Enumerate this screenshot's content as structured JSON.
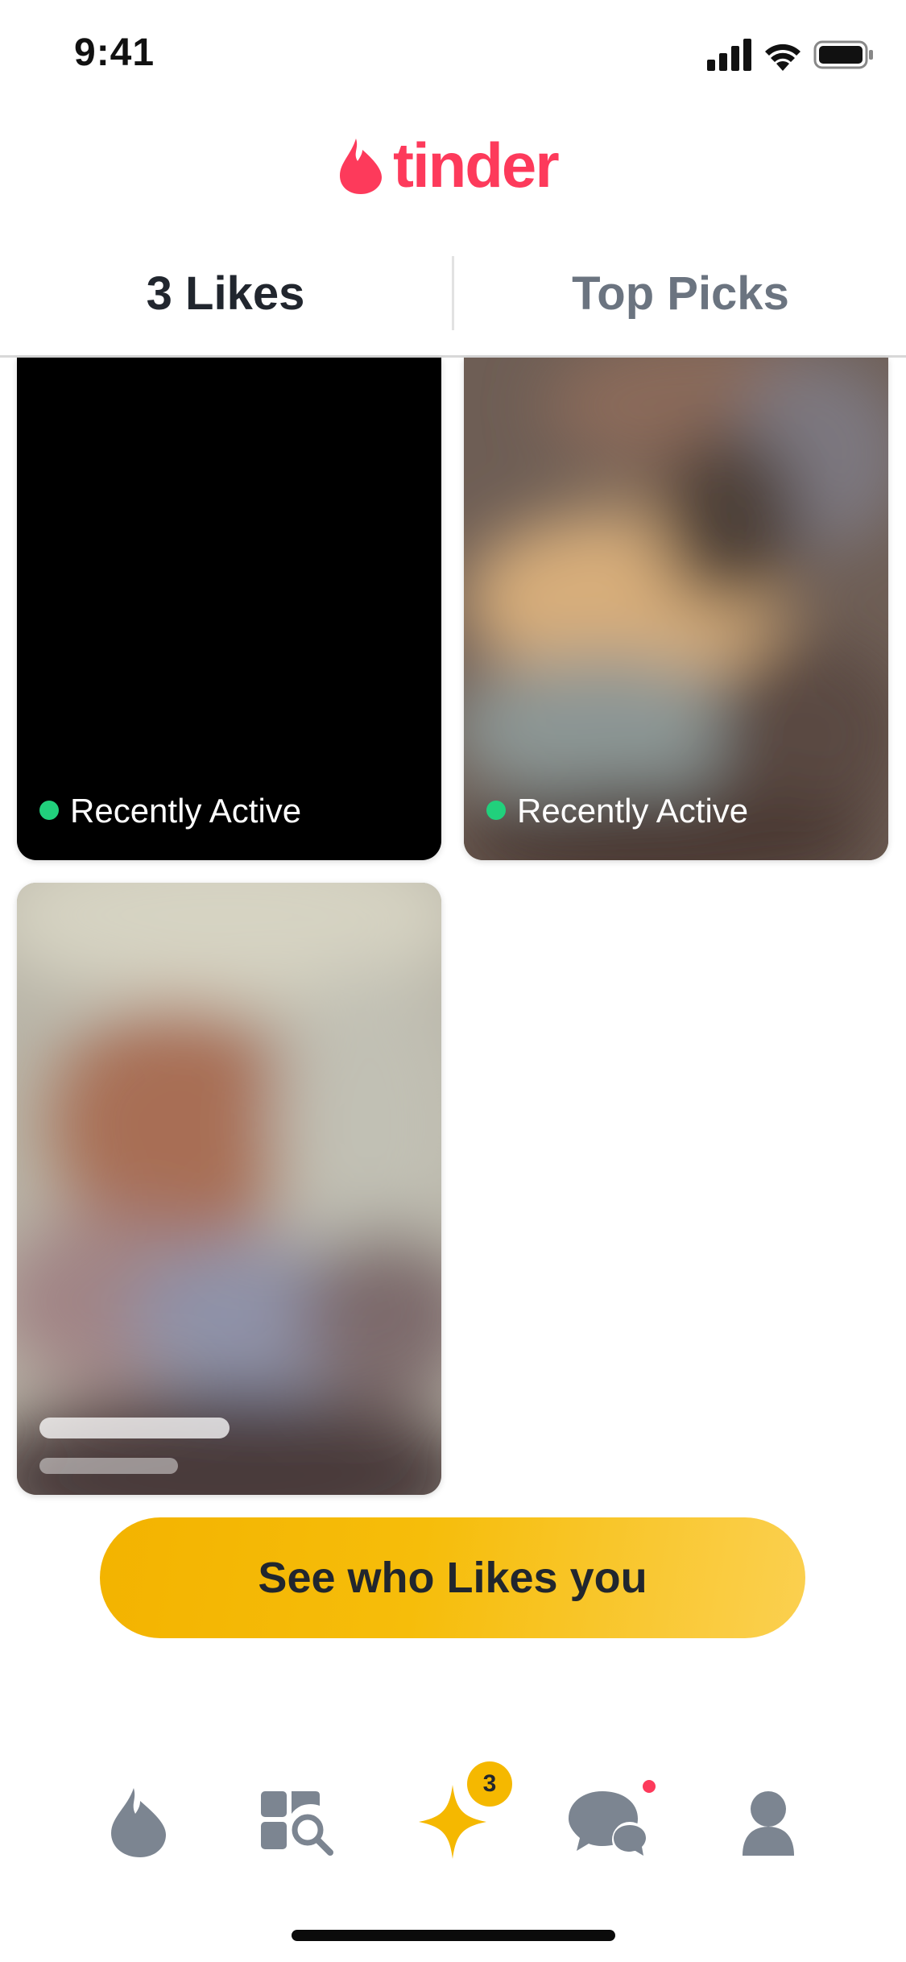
{
  "status_bar": {
    "time": "9:41",
    "icons": [
      "cellular-signal-icon",
      "wifi-icon",
      "battery-icon"
    ]
  },
  "header": {
    "logo_text": "tinder",
    "logo_icon": "flame-icon",
    "brand_color": "#fd3a5b"
  },
  "tabs": [
    {
      "label": "3 Likes",
      "selected": true
    },
    {
      "label": "Top Picks",
      "selected": false
    }
  ],
  "cards": [
    {
      "status": "Recently Active",
      "status_color": "#21d07c"
    },
    {
      "status": "Recently Active",
      "status_color": "#21d07c"
    },
    {
      "status": ""
    }
  ],
  "cta": {
    "label": "See who Likes you",
    "color": "#f5b800"
  },
  "bottom_nav": {
    "items": [
      {
        "icon": "flame-icon",
        "active": false
      },
      {
        "icon": "explore-icon",
        "active": false
      },
      {
        "icon": "sparkle-icon",
        "active": true,
        "badge": "3"
      },
      {
        "icon": "chat-icon",
        "active": false,
        "notification_dot": true
      },
      {
        "icon": "profile-icon",
        "active": false
      }
    ],
    "inactive_color": "#7c8591",
    "active_color": "#f5b800"
  }
}
